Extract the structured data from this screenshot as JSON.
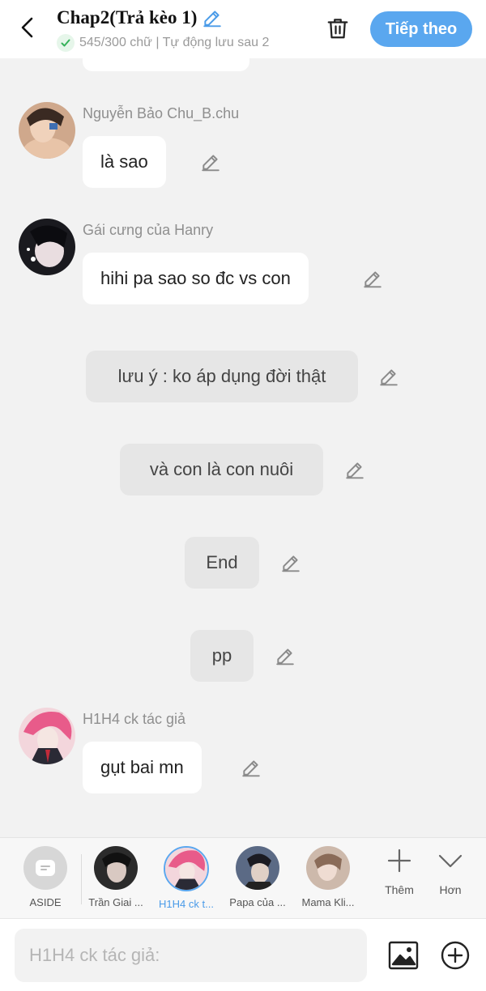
{
  "header": {
    "title": "Chap2(Trả kèo 1)",
    "status": "545/300 chữ | Tự động lưu sau 2",
    "next_label": "Tiếp theo"
  },
  "messages": [
    {
      "sender": "Nguyễn Bảo Chu_B.chu",
      "text": "là sao"
    },
    {
      "sender": "Gái cưng của Hanry",
      "text": "hihi pa sao so đc vs con"
    },
    {
      "text": "lưu ý : ko áp dụng đời thật"
    },
    {
      "text": "và con là con nuôi"
    },
    {
      "text": "End"
    },
    {
      "text": "pp"
    },
    {
      "sender": "H1H4 ck tác giả",
      "text": "gụt bai mn"
    }
  ],
  "characters": [
    {
      "name": "ASIDE"
    },
    {
      "name": "Trần Giai ..."
    },
    {
      "name": "H1H4 ck t...",
      "selected": true
    },
    {
      "name": "Papa của ..."
    },
    {
      "name": "Mama Kli..."
    }
  ],
  "tools": {
    "more_label": "Thêm",
    "expand_label": "Hơn"
  },
  "input": {
    "placeholder": "H1H4 ck tác giả:"
  },
  "colors": {
    "accent": "#5aa7ef",
    "background": "#f2f2f2"
  }
}
